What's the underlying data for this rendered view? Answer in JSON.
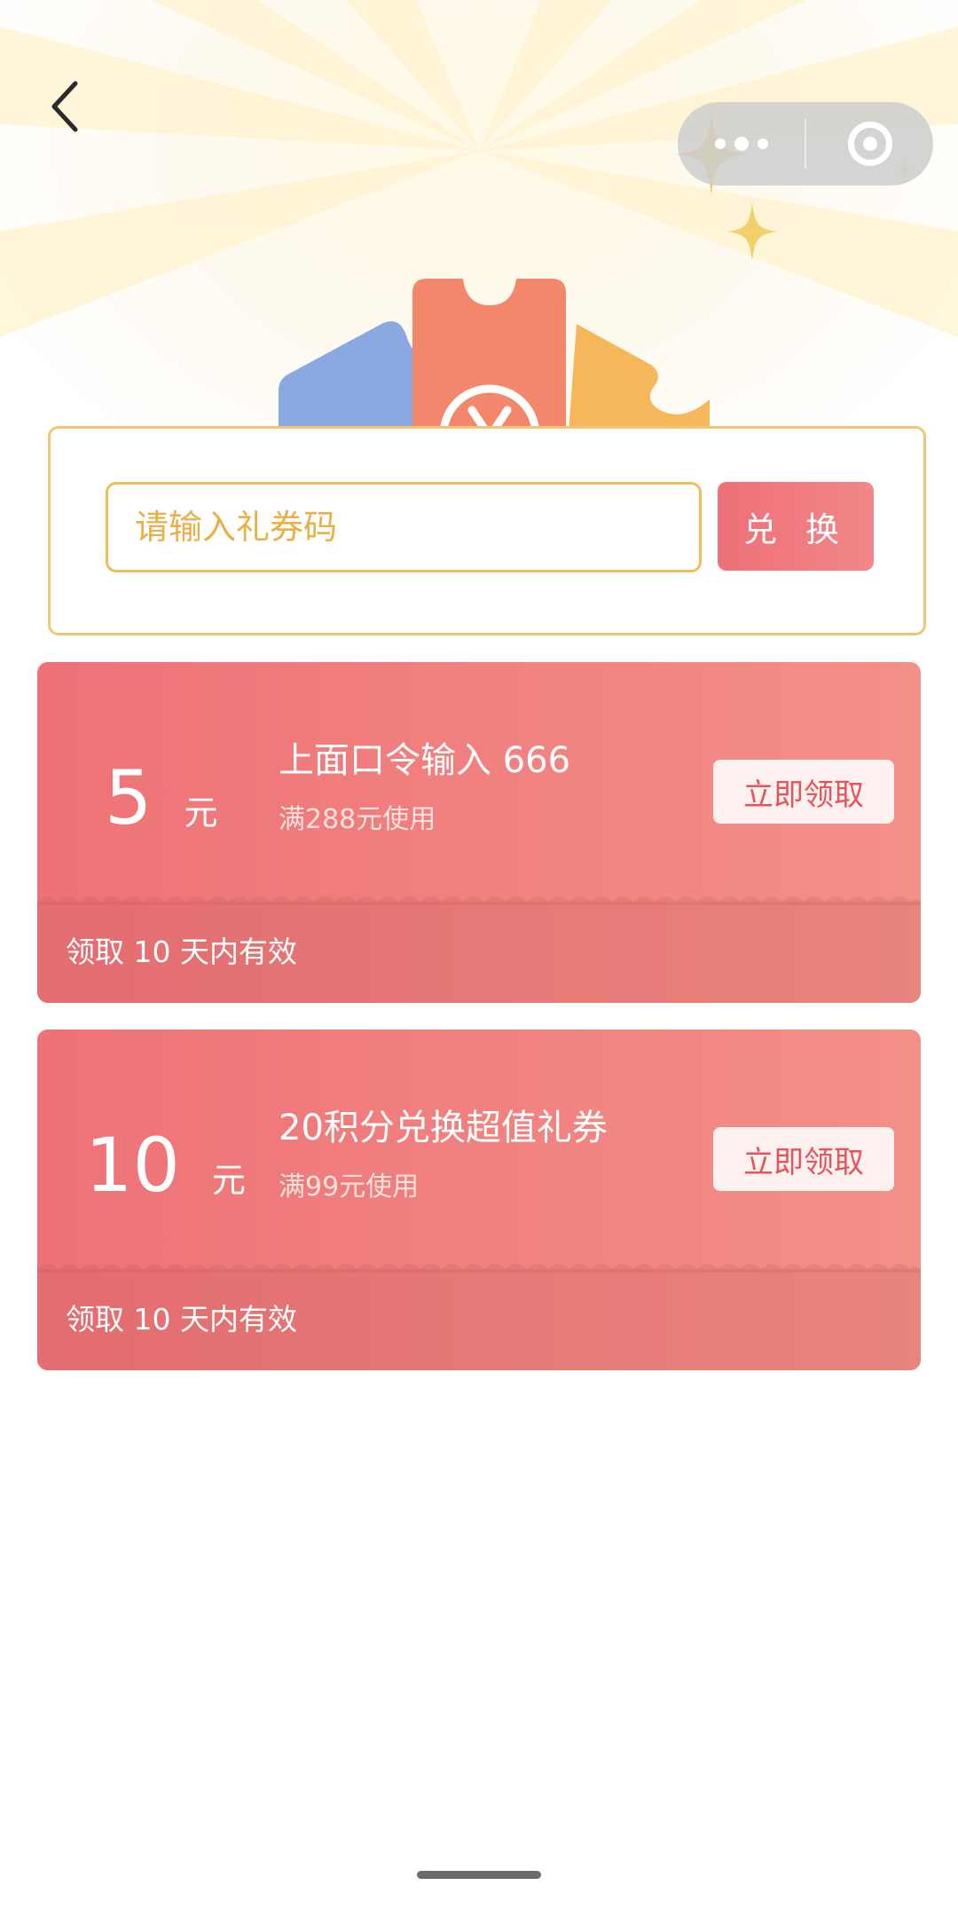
{
  "nav": {
    "back_icon": "chevron-left-icon",
    "more_icon": "more-dots-icon",
    "close_icon": "target-close-icon"
  },
  "redeem": {
    "placeholder": "请输入礼券码",
    "button_label": "兑 换"
  },
  "coupons": [
    {
      "amount": "5",
      "unit": "元",
      "title": "上面口令输入 666",
      "condition": "满288元使用",
      "claim_label": "立即领取",
      "validity": "领取 10 天内有效"
    },
    {
      "amount": "10",
      "unit": "元",
      "title": "20积分兑换超值礼券",
      "condition": "满99元使用",
      "claim_label": "立即领取",
      "validity": "领取 10 天内有效"
    }
  ],
  "colors": {
    "accent": "#ee6f77",
    "border_gold": "#efc873",
    "placeholder_gold": "#e8b048",
    "ticket_blue": "#8aa9e0",
    "ticket_red": "#f2876c",
    "ticket_yellow": "#f6b75a"
  }
}
